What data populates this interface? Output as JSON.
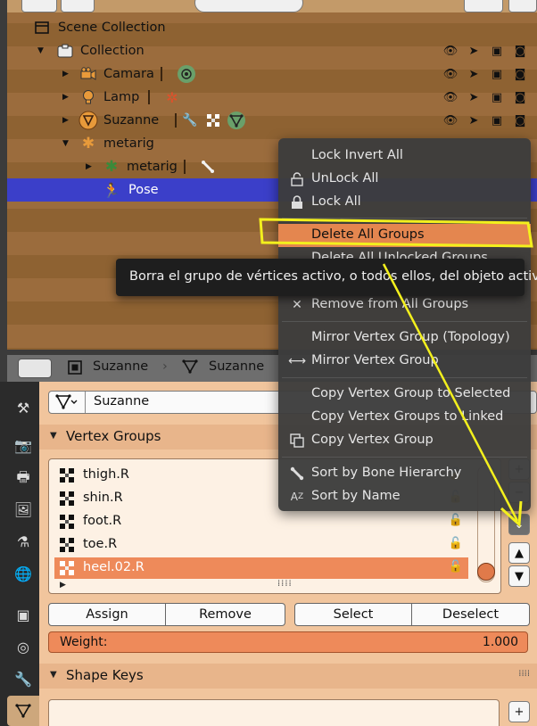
{
  "colors": {
    "accent": "#ee8a5a",
    "selection": "#3b3fc9",
    "annotation": "#f3f01d",
    "menu_bg": "#3c3c3c",
    "panel_bg": "#f1c59d"
  },
  "outliner": {
    "rows": [
      {
        "label": "Scene Collection",
        "icon": "scene-collection-icon"
      },
      {
        "label": "Collection",
        "icon": "collection-icon"
      },
      {
        "label": "Camara",
        "icon": "camera-icon"
      },
      {
        "label": "Lamp",
        "icon": "lamp-icon"
      },
      {
        "label": "Suzanne",
        "icon": "mesh-icon"
      },
      {
        "label": "metarig",
        "icon": "armature-icon"
      },
      {
        "label": "metarig",
        "icon": "armature-data-icon"
      },
      {
        "label": "Pose",
        "icon": "pose-icon"
      }
    ]
  },
  "props_header": {
    "object": "Suzanne",
    "data": "Suzanne"
  },
  "object_data": {
    "name": "Suzanne"
  },
  "vertex_groups": {
    "title": "Vertex Groups",
    "items": [
      {
        "name": "thigh.R"
      },
      {
        "name": "shin.R"
      },
      {
        "name": "foot.R"
      },
      {
        "name": "toe.R"
      },
      {
        "name": "heel.02.R"
      }
    ],
    "active_index": 4,
    "buttons": {
      "assign": "Assign",
      "remove": "Remove",
      "select": "Select",
      "deselect": "Deselect"
    },
    "weight_label": "Weight:",
    "weight_value": "1.000"
  },
  "shape_keys": {
    "title": "Shape Keys"
  },
  "context_menu": {
    "items": [
      {
        "label": "Lock Invert All",
        "icon": ""
      },
      {
        "label": "UnLock All",
        "icon": "unlock-icon"
      },
      {
        "label": "Lock All",
        "icon": "lock-icon"
      },
      {
        "label": "Delete All Groups",
        "icon": ""
      },
      {
        "label": "Delete All Unlocked Groups",
        "icon": ""
      },
      {
        "label": "Remove from All Groups",
        "icon": "x-icon"
      },
      {
        "label": "Mirror Vertex Group (Topology)",
        "icon": ""
      },
      {
        "label": "Mirror Vertex Group",
        "icon": "mirror-icon"
      },
      {
        "label": "Copy Vertex Group to Selected",
        "icon": ""
      },
      {
        "label": "Copy Vertex Groups to Linked",
        "icon": ""
      },
      {
        "label": "Copy Vertex Group",
        "icon": "copy-icon"
      },
      {
        "label": "Sort by Bone Hierarchy",
        "icon": "bone-icon"
      },
      {
        "label": "Sort by Name",
        "icon": "sort-alpha-icon"
      }
    ],
    "highlighted_index": 3
  },
  "tooltip": {
    "text": "Borra el grupo de vértices activo, o todos ellos, del objeto activo."
  }
}
